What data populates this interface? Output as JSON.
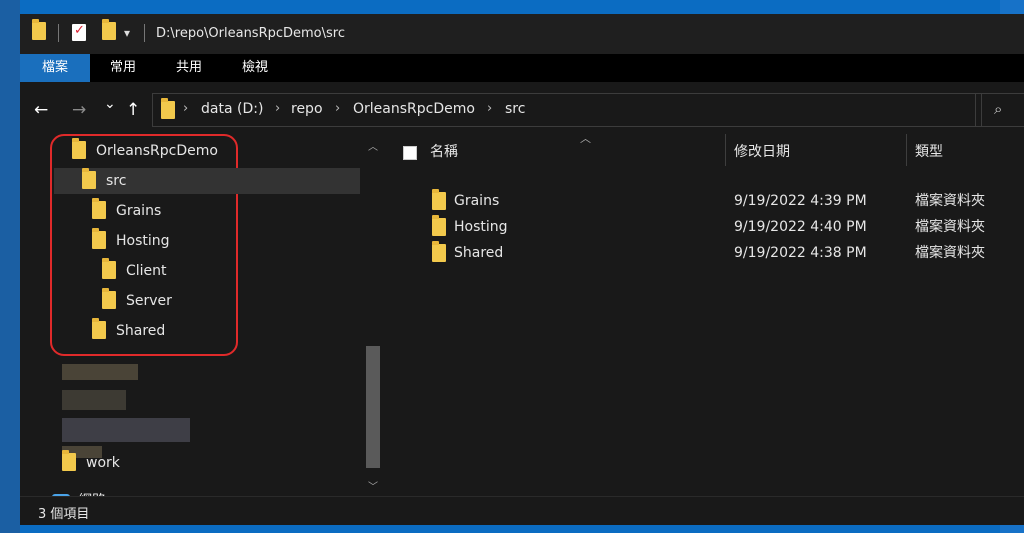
{
  "title": {
    "path": "D:\\repo\\OrleansRpcDemo\\src"
  },
  "ribbon": {
    "tabs": [
      "檔案",
      "常用",
      "共用",
      "檢視"
    ]
  },
  "nav": {
    "back": "←",
    "forward": "→",
    "recent": "⌄",
    "up": "↑"
  },
  "breadcrumb": [
    "data (D:)",
    "repo",
    "OrleansRpcDemo",
    "src"
  ],
  "address": {
    "dropdown": "⌄",
    "refresh": "↻"
  },
  "search": {
    "icon": "⌕"
  },
  "tree": {
    "root": "OrleansRpcDemo",
    "src": "src",
    "grains": "Grains",
    "hosting": "Hosting",
    "client": "Client",
    "server": "Server",
    "shared": "Shared",
    "work": "work",
    "network": "網路"
  },
  "columns": {
    "name": "名稱",
    "modified": "修改日期",
    "type": "類型"
  },
  "files": [
    {
      "name": "Grains",
      "date": "9/19/2022 4:39 PM",
      "type": "檔案資料夾"
    },
    {
      "name": "Hosting",
      "date": "9/19/2022 4:40 PM",
      "type": "檔案資料夾"
    },
    {
      "name": "Shared",
      "date": "9/19/2022 4:38 PM",
      "type": "檔案資料夾"
    }
  ],
  "status": {
    "count": "3 個項目"
  },
  "colors": {
    "accent": "#1a6fbd",
    "highlight": "#e02a2a",
    "folder": "#f2c94c"
  }
}
